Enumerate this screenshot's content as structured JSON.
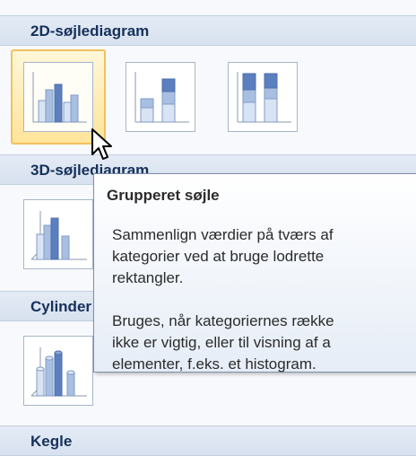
{
  "gallery": {
    "sections": [
      {
        "title": "2D-søjlediagram"
      },
      {
        "title": "3D-søjlediagram"
      },
      {
        "title": "Cylinder"
      },
      {
        "title": "Kegle"
      }
    ],
    "selected_item": "Grupperet søjle"
  },
  "tooltip": {
    "title": "Grupperet søjle",
    "lines": [
      "Sammenlign værdier på tværs af",
      "kategorier ved at bruge lodrette",
      "rektangler.",
      "Bruges, når kategoriernes række",
      "ikke er vigtig, eller til visning af a",
      "elementer, f.eks. et histogram."
    ]
  },
  "colors": {
    "header_bg": "#dbe4f0",
    "header_text": "#15305a",
    "selected_border": "#f1c15f",
    "bar_blue": "#5b7fbf"
  }
}
